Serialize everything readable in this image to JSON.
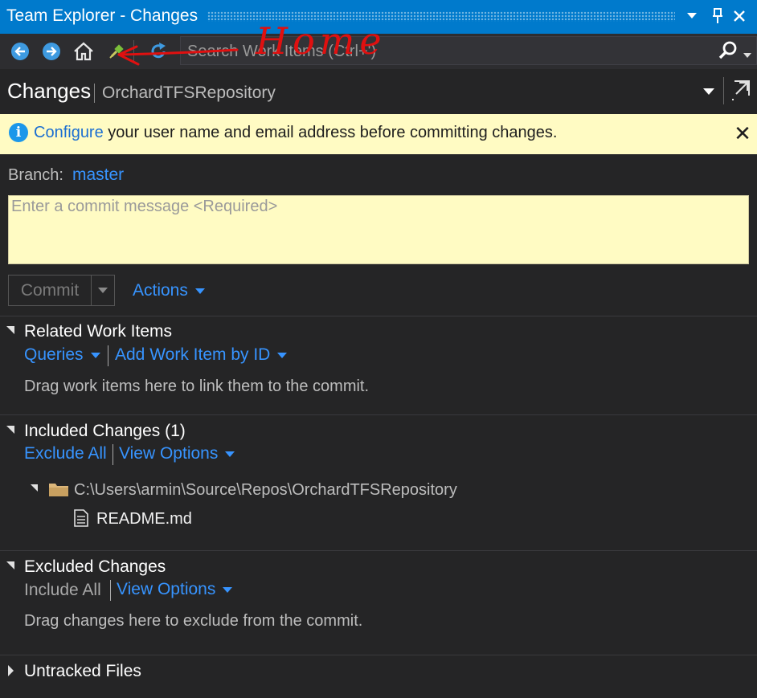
{
  "window": {
    "title": "Team Explorer - Changes"
  },
  "toolbar": {
    "search_placeholder": "Search Work Items (Ctrl+')",
    "annotation": "Home"
  },
  "header": {
    "title": "Changes",
    "subtitle": "OrchardTFSRepository"
  },
  "info": {
    "link": "Configure",
    "text": "your user name and email address before committing changes."
  },
  "branch": {
    "label": "Branch:",
    "value": "master"
  },
  "commit": {
    "placeholder": "Enter a commit message <Required>",
    "button": "Commit",
    "actions": "Actions"
  },
  "related": {
    "title": "Related Work Items",
    "queries": "Queries",
    "add_by_id": "Add Work Item by ID",
    "hint": "Drag work items here to link them to the commit."
  },
  "included": {
    "title": "Included Changes (1)",
    "exclude_all": "Exclude All",
    "view_options": "View Options",
    "folder": "C:\\Users\\armin\\Source\\Repos\\OrchardTFSRepository",
    "file": "README.md"
  },
  "excluded": {
    "title": "Excluded Changes",
    "include_all": "Include All",
    "view_options": "View Options",
    "hint": "Drag changes here to exclude from the commit."
  },
  "untracked": {
    "title": "Untracked Files"
  },
  "colors": {
    "accent": "#007acc",
    "link": "#3794ff",
    "info_bg": "#fffbc3",
    "bg": "#252526"
  },
  "icons": [
    "back-arrow-icon",
    "forward-arrow-icon",
    "home-icon",
    "plug-icon",
    "refresh-icon",
    "search-icon",
    "info-icon",
    "close-icon",
    "folder-icon",
    "file-icon"
  ]
}
